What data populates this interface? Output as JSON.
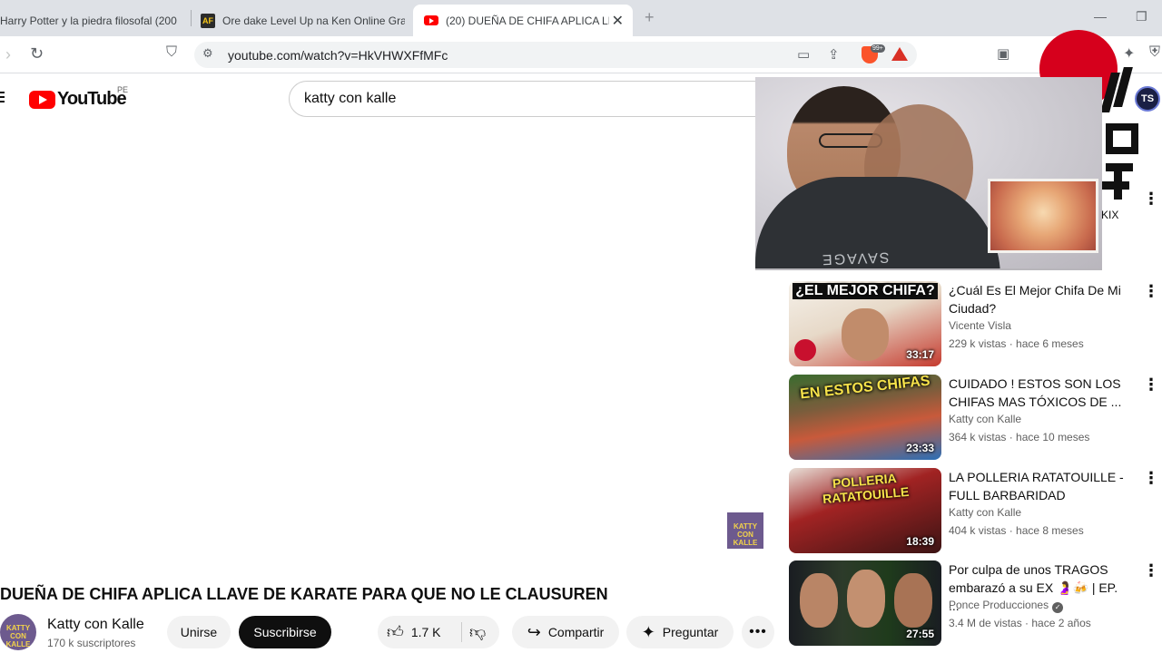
{
  "browser": {
    "tabs": [
      {
        "title": "Harry Potter y la piedra filosofal (200"
      },
      {
        "title": "Ore dake Level Up na Ken Online Gra",
        "favicon": "AF"
      },
      {
        "title": "(20) DUEÑA DE CHIFA APLICA LL"
      }
    ],
    "url": "youtube.com/watch?v=HkVHWXFfMFc",
    "extension_badge": "99+"
  },
  "youtube": {
    "logo": "YouTube",
    "country": "PE",
    "search_value": "katty con kalle"
  },
  "overlay": {
    "shirt_text": "SAVAGE",
    "partial_label": "KIX",
    "avatar_initials": "TS"
  },
  "video": {
    "watermark": "KATTY CON KALLE",
    "title": "DUEÑA DE CHIFA APLICA LLAVE DE KARATE PARA QUE NO LE CLAUSUREN",
    "channel": "Katty con Kalle",
    "subscribers": "170 k suscriptores",
    "join_label": "Unirse",
    "subscribe_label": "Suscribirse",
    "likes": "1.7 K",
    "share_label": "Compartir",
    "ask_label": "Preguntar"
  },
  "recommendations": [
    {
      "title": "¿Cuál Es El Mejor Chifa De Mi Ciudad?",
      "channel": "Vicente Visla",
      "meta": "229 k vistas · hace 6 meses",
      "duration": "33:17",
      "thumb_caption": "¿EL MEJOR CHIFA?"
    },
    {
      "title": "CUIDADO ! ESTOS SON LOS CHIFAS MAS TÓXICOS DE ...",
      "channel": "Katty con Kalle",
      "meta": "364 k vistas · hace 10 meses",
      "duration": "23:33",
      "thumb_caption": "EN ESTOS CHIFAS"
    },
    {
      "title": "LA POLLERIA RATATOUILLE - FULL BARBARIDAD",
      "channel": "Katty con Kalle",
      "meta": "404 k vistas · hace 8 meses",
      "duration": "18:39",
      "thumb_caption": "POLLERIA RATATOUILLE"
    },
    {
      "title": "Por culpa de unos TRAGOS embarazó a su EX 🤰🍻 | EP. ...",
      "channel": "Ponce Producciones",
      "meta": "3.4 M de vistas · hace 2 años",
      "duration": "27:55",
      "thumb_caption": ""
    }
  ],
  "icons": {
    "tab_close": "close-icon",
    "reload": "reload-icon",
    "bookmark": "bookmark-icon",
    "like": "thumbs-up-icon",
    "dislike": "thumbs-down-icon",
    "share": "share-icon",
    "ask": "sparkle-icon",
    "more": "more-horizontal-icon"
  },
  "colors": {
    "brand_red": "#ff0000",
    "subscribe_bg": "#0f0f0f",
    "pill_bg": "#f2f2f2"
  }
}
